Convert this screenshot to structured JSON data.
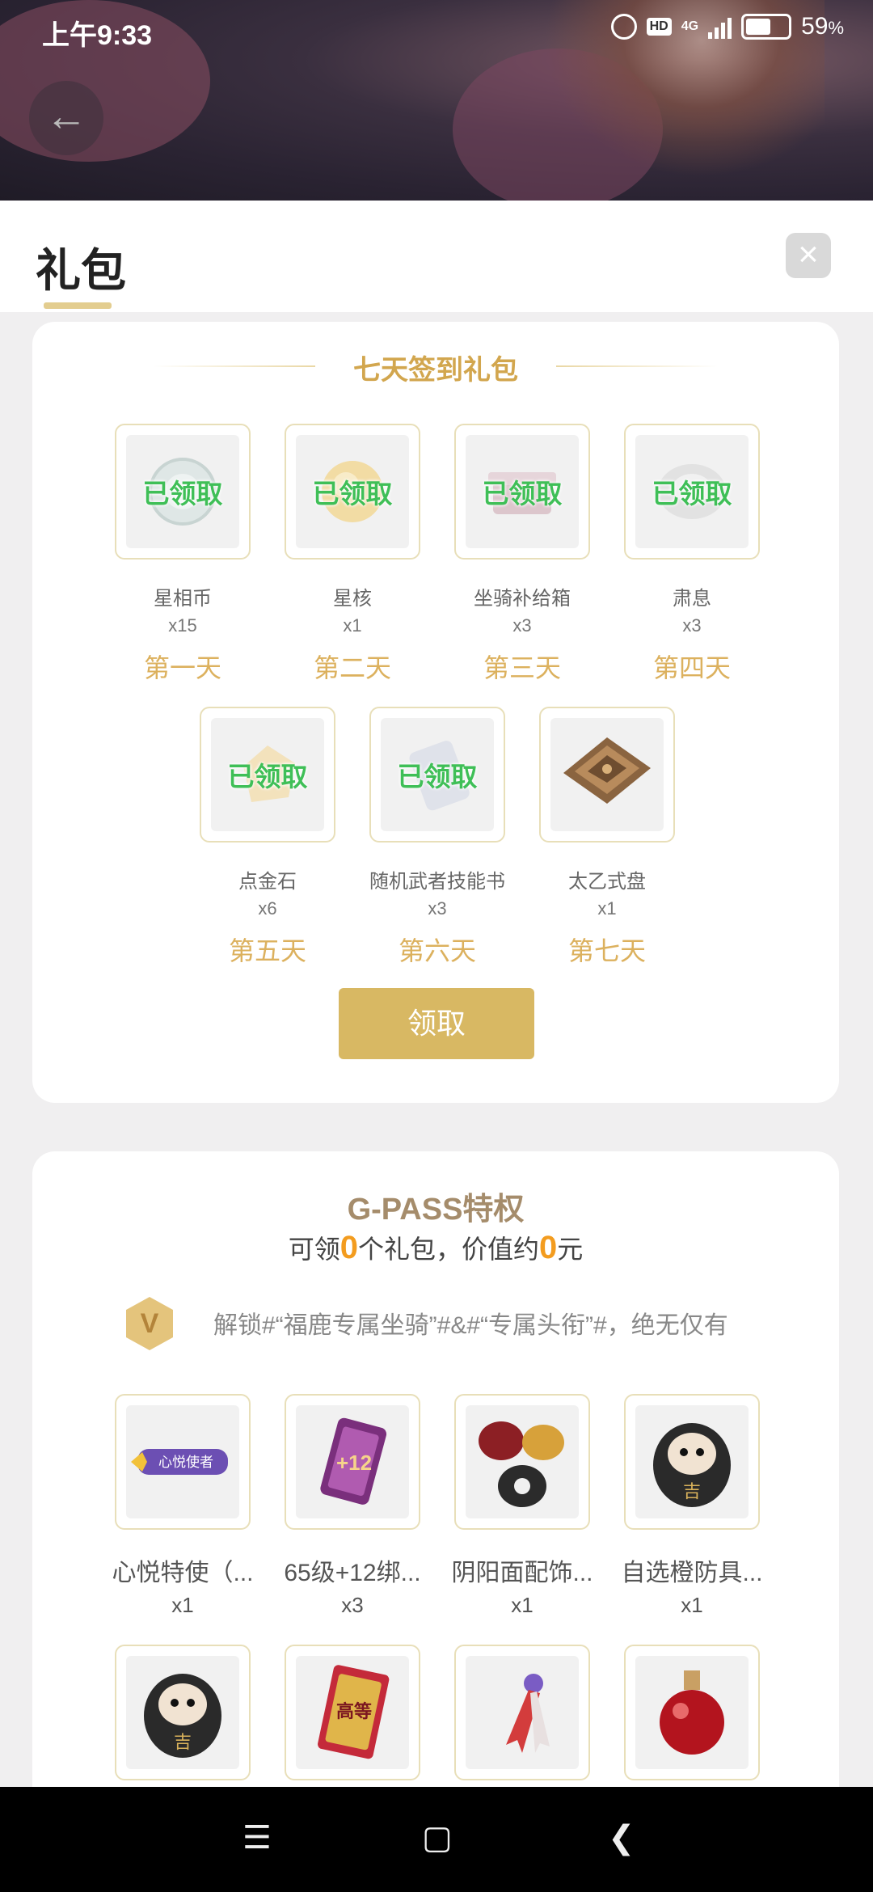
{
  "status_bar": {
    "time": "上午9:33",
    "battery_percent": "59",
    "battery_unit": "%",
    "network": "4G",
    "hd": "HD"
  },
  "header": {
    "title": "礼包"
  },
  "checkin": {
    "title": "七天签到礼包",
    "claimed_label": "已领取",
    "claim_button": "领取",
    "items": [
      {
        "name": "星相币",
        "qty": "x15",
        "day": "第一天",
        "claimed": true
      },
      {
        "name": "星核",
        "qty": "x1",
        "day": "第二天",
        "claimed": true
      },
      {
        "name": "坐骑补给箱",
        "qty": "x3",
        "day": "第三天",
        "claimed": true
      },
      {
        "name": "肃息",
        "qty": "x3",
        "day": "第四天",
        "claimed": true
      },
      {
        "name": "点金石",
        "qty": "x6",
        "day": "第五天",
        "claimed": true
      },
      {
        "name": "随机武者技能书",
        "qty": "x3",
        "day": "第六天",
        "claimed": true
      },
      {
        "name": "太乙式盘",
        "qty": "x1",
        "day": "第七天",
        "claimed": false
      }
    ]
  },
  "gpass": {
    "title": "G-PASS特权",
    "sub_prefix": "可领",
    "gift_count": "0",
    "sub_middle": "个礼包，价值约",
    "value": "0",
    "sub_suffix": "元",
    "badge_letter": "V",
    "description": "解锁#“福鹿专属坐骑”#&#“专属头衔”#，绝无仅有",
    "items": [
      {
        "name": "心悦特使（...",
        "qty": "x1",
        "icon_text": "心悦使者"
      },
      {
        "name": "65级+12绑...",
        "qty": "x3",
        "icon_text": "+12"
      },
      {
        "name": "阴阳面配饰...",
        "qty": "x1",
        "icon_text": ""
      },
      {
        "name": "自选橙防具...",
        "qty": "x1",
        "icon_text": "吉"
      },
      {
        "name": "",
        "qty": "",
        "icon_text": "吉"
      },
      {
        "name": "",
        "qty": "",
        "icon_text": "高等"
      },
      {
        "name": "",
        "qty": "",
        "icon_text": ""
      },
      {
        "name": "",
        "qty": "",
        "icon_text": ""
      }
    ]
  },
  "navbar": {
    "menu_icon": "menu-icon",
    "home_icon": "home-icon",
    "back_icon": "back-icon"
  },
  "colors": {
    "gold": "#d8b863",
    "claimed_green": "#3fbf57",
    "title_gold": "#d2a64e"
  }
}
